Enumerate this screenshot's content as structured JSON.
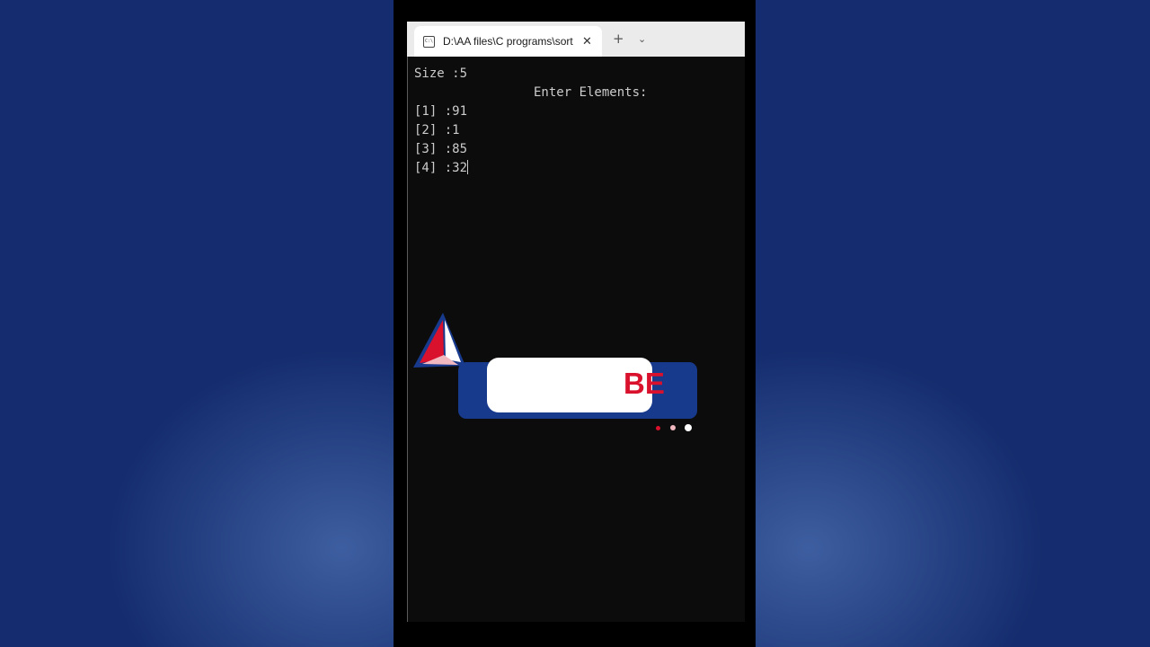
{
  "window": {
    "tab_title": "D:\\AA files\\C programs\\sorte",
    "tab_icon": "C:\\",
    "close_glyph": "✕",
    "new_tab_glyph": "+",
    "dropdown_glyph": "⌄"
  },
  "terminal": {
    "size_line": "Size :5",
    "prompt_line": "Enter Elements:",
    "entries": [
      "[1] :91",
      "[2] :1",
      "[3] :85",
      "[4] :32"
    ]
  },
  "overlay": {
    "text": "BE",
    "colors": {
      "blue": "#183a8c",
      "red": "#d9112c",
      "pink": "#f2b8c0",
      "white": "#ffffff"
    }
  }
}
